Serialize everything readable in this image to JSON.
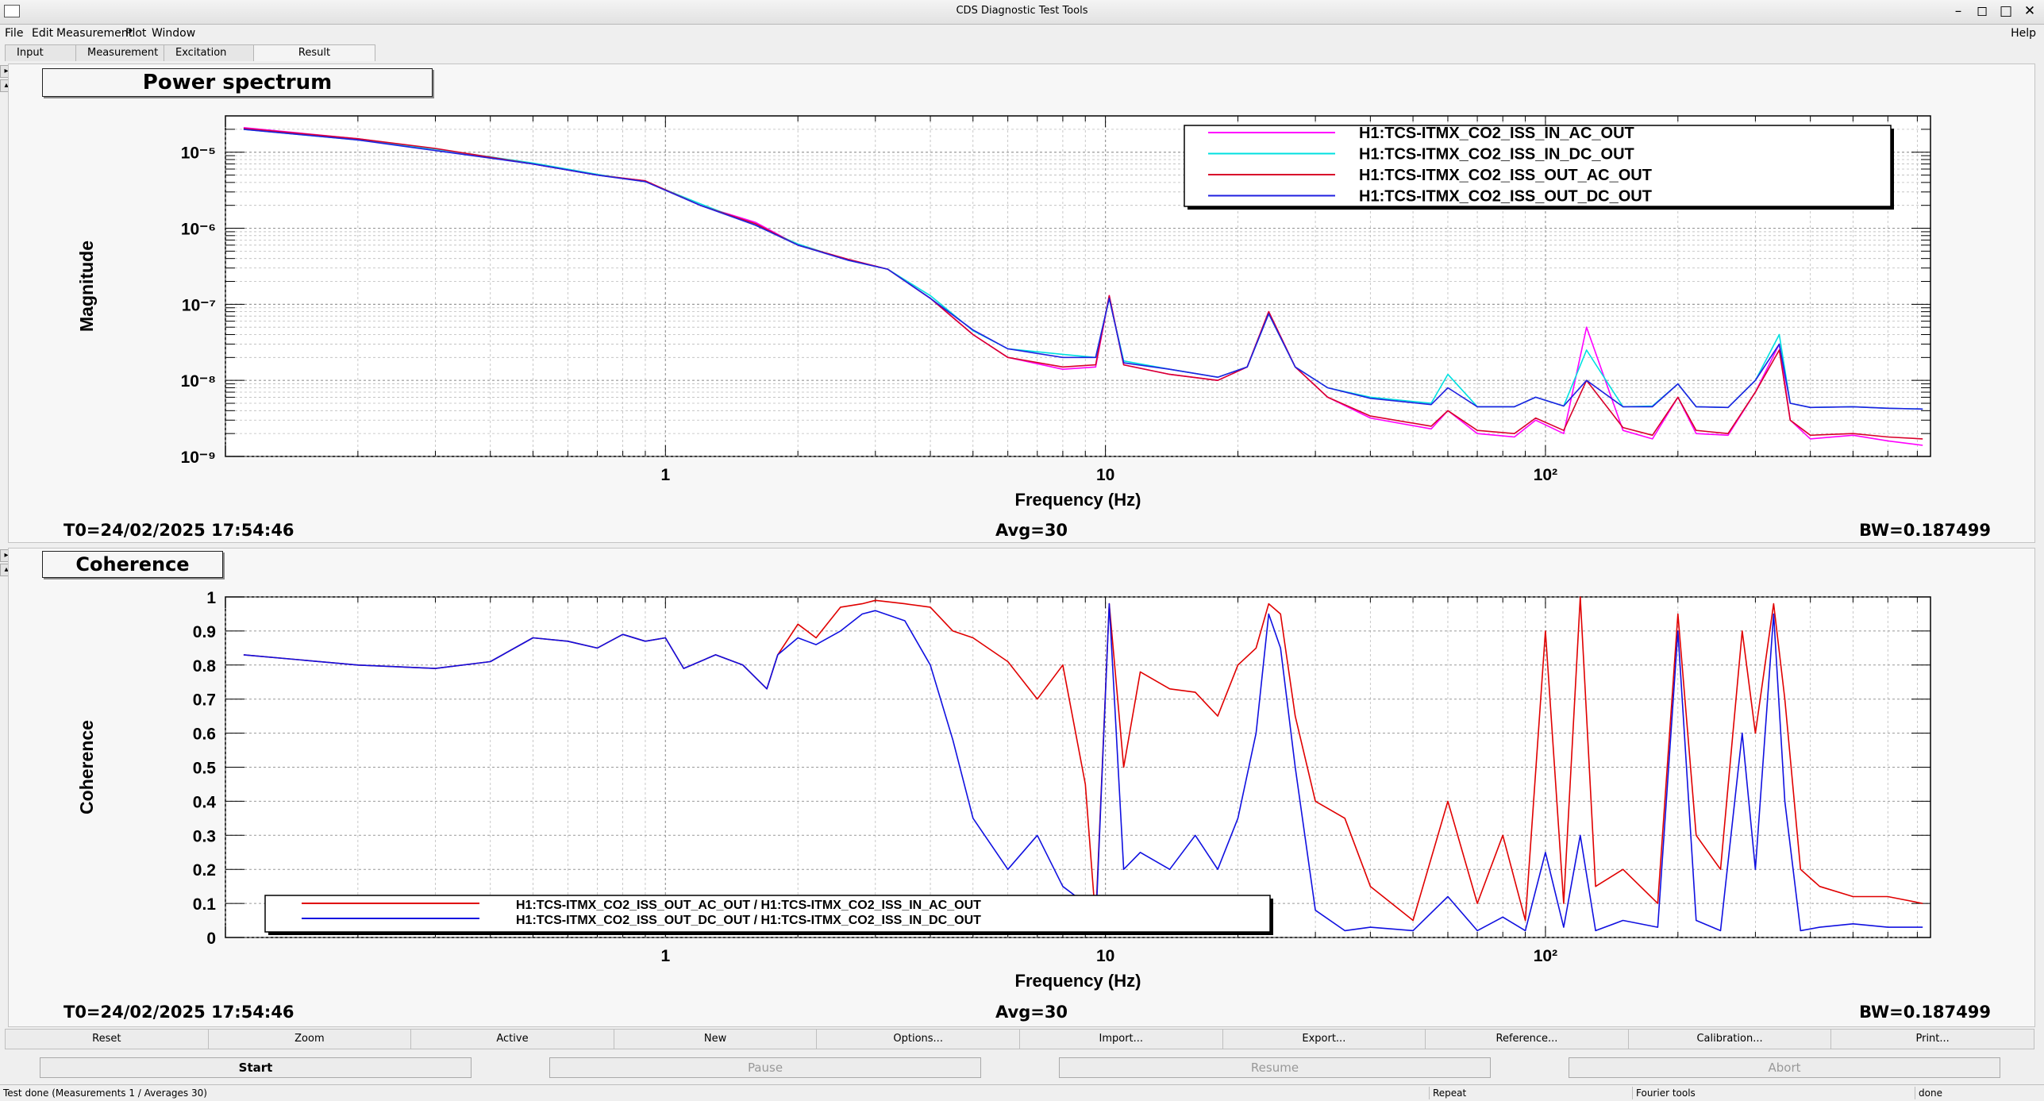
{
  "window": {
    "title": "CDS Diagnostic Test Tools"
  },
  "menu": {
    "items": [
      "File",
      "Edit",
      "Measurement",
      "Plot",
      "Window"
    ],
    "help": "Help"
  },
  "tabs": [
    "Input",
    "Measurement",
    "Excitation",
    "Result"
  ],
  "active_tab": "Result",
  "plots": [
    {
      "title": "Power spectrum",
      "ylabel": "Magnitude",
      "xlabel": "Frequency (Hz)",
      "info": {
        "t0": "T0=24/02/2025 17:54:46",
        "avg": "Avg=30",
        "bw": "BW=0.187499"
      },
      "chart_data": {
        "type": "line",
        "title": "Power spectrum",
        "xlabel": "Frequency (Hz)",
        "ylabel": "Magnitude",
        "xscale": "log",
        "yscale": "log",
        "xlim": [
          0.1,
          750
        ],
        "ylim": [
          1e-09,
          3e-05
        ],
        "grid": true,
        "legend": "top-right",
        "x_tick_labels": [
          "1",
          "10",
          "10²"
        ],
        "y_tick_labels": [
          "10⁻⁵",
          "10⁻⁶",
          "10⁻⁷",
          "10⁻⁸",
          "10⁻⁹"
        ],
        "series": [
          {
            "name": "H1:TCS-ITMX_CO2_ISS_IN_AC_OUT",
            "color": "#ff00ff",
            "x": [
              0.11,
              0.2,
              0.3,
              0.5,
              0.7,
              0.9,
              1.2,
              1.6,
              2.0,
              2.6,
              3.2,
              4.0,
              5.0,
              6.0,
              8.0,
              9.5,
              10.2,
              11,
              14,
              18,
              21,
              23.5,
              27,
              32,
              40,
              55,
              60,
              70,
              85,
              95,
              110,
              124,
              150,
              175,
              200,
              220,
              260,
              300,
              340,
              360,
              400,
              500,
              600,
              720
            ],
            "y": [
              2.1e-05,
              1.5e-05,
              1.1e-05,
              7e-06,
              5e-06,
              4.2e-06,
              2e-06,
              1.2e-06,
              6e-07,
              3.9e-07,
              2.9e-07,
              1.2e-07,
              4e-08,
              2e-08,
              1.4e-08,
              1.5e-08,
              1.3e-07,
              1.6e-08,
              1.2e-08,
              1e-08,
              1.5e-08,
              8e-08,
              1.5e-08,
              6e-09,
              3.2e-09,
              2.3e-09,
              4e-09,
              2e-09,
              1.8e-09,
              3e-09,
              2e-09,
              5e-08,
              2.2e-09,
              1.7e-09,
              6e-09,
              2e-09,
              1.9e-09,
              7e-09,
              3e-08,
              3e-09,
              1.7e-09,
              1.9e-09,
              1.6e-09,
              1.4e-09
            ]
          },
          {
            "name": "H1:TCS-ITMX_CO2_ISS_IN_DC_OUT",
            "color": "#00e0e0",
            "x": [
              0.11,
              0.2,
              0.3,
              0.5,
              0.7,
              0.9,
              1.2,
              1.6,
              2.0,
              2.6,
              3.2,
              4.0,
              5.0,
              6.0,
              8.0,
              9.5,
              10.2,
              11,
              14,
              18,
              21,
              23.5,
              27,
              32,
              40,
              55,
              60,
              70,
              85,
              95,
              110,
              124,
              150,
              175,
              200,
              220,
              260,
              300,
              340,
              360,
              400,
              500,
              600,
              720
            ],
            "y": [
              2e-05,
              1.45e-05,
              1.1e-05,
              7.2e-06,
              5.1e-06,
              4.1e-06,
              2.1e-06,
              1.1e-06,
              6.2e-07,
              3.8e-07,
              2.9e-07,
              1.3e-07,
              4.5e-08,
              2.6e-08,
              2.2e-08,
              2e-08,
              1.2e-07,
              1.8e-08,
              1.4e-08,
              1.1e-08,
              1.5e-08,
              7.5e-08,
              1.5e-08,
              8e-09,
              6e-09,
              5e-09,
              1.2e-08,
              4.5e-09,
              4.5e-09,
              6e-09,
              4.6e-09,
              2.5e-08,
              4.5e-09,
              4.6e-09,
              9e-09,
              4.5e-09,
              4.4e-09,
              1e-08,
              4e-08,
              5e-09,
              4.4e-09,
              4.5e-09,
              4.3e-09,
              4.2e-09
            ]
          },
          {
            "name": "H1:TCS-ITMX_CO2_ISS_OUT_AC_OUT",
            "color": "#d8002a",
            "x": [
              0.11,
              0.2,
              0.3,
              0.5,
              0.7,
              0.9,
              1.2,
              1.6,
              2.0,
              2.6,
              3.2,
              4.0,
              5.0,
              6.0,
              8.0,
              9.5,
              10.2,
              11,
              14,
              18,
              21,
              23.5,
              27,
              32,
              40,
              55,
              60,
              70,
              85,
              95,
              110,
              124,
              150,
              175,
              200,
              220,
              260,
              300,
              340,
              360,
              400,
              500,
              600,
              720
            ],
            "y": [
              2.05e-05,
              1.5e-05,
              1.12e-05,
              7e-06,
              5e-06,
              4.2e-06,
              2e-06,
              1.15e-06,
              6e-07,
              3.9e-07,
              2.9e-07,
              1.2e-07,
              4e-08,
              2e-08,
              1.5e-08,
              1.6e-08,
              1.3e-07,
              1.6e-08,
              1.2e-08,
              1e-08,
              1.5e-08,
              8e-08,
              1.5e-08,
              6e-09,
              3.4e-09,
              2.5e-09,
              4e-09,
              2.2e-09,
              2e-09,
              3.2e-09,
              2.2e-09,
              1e-08,
              2.4e-09,
              1.9e-09,
              6e-09,
              2.2e-09,
              2e-09,
              7e-09,
              2.5e-08,
              3e-09,
              1.9e-09,
              2e-09,
              1.8e-09,
              1.7e-09
            ]
          },
          {
            "name": "H1:TCS-ITMX_CO2_ISS_OUT_DC_OUT",
            "color": "#2020e0",
            "x": [
              0.11,
              0.2,
              0.3,
              0.5,
              0.7,
              0.9,
              1.2,
              1.6,
              2.0,
              2.6,
              3.2,
              4.0,
              5.0,
              6.0,
              8.0,
              9.5,
              10.2,
              11,
              14,
              18,
              21,
              23.5,
              27,
              32,
              40,
              55,
              60,
              70,
              85,
              95,
              110,
              124,
              150,
              175,
              200,
              220,
              260,
              300,
              340,
              360,
              400,
              500,
              600,
              720
            ],
            "y": [
              2e-05,
              1.45e-05,
              1.05e-05,
              7e-06,
              5e-06,
              4.1e-06,
              2e-06,
              1.1e-06,
              6e-07,
              3.8e-07,
              2.9e-07,
              1.2e-07,
              4.6e-08,
              2.6e-08,
              2e-08,
              2e-08,
              1.2e-07,
              1.7e-08,
              1.4e-08,
              1.1e-08,
              1.5e-08,
              7.5e-08,
              1.5e-08,
              8e-09,
              5.8e-09,
              4.8e-09,
              8e-09,
              4.5e-09,
              4.5e-09,
              6e-09,
              4.6e-09,
              1e-08,
              4.5e-09,
              4.5e-09,
              9e-09,
              4.5e-09,
              4.4e-09,
              1e-08,
              3e-08,
              5e-09,
              4.4e-09,
              4.5e-09,
              4.3e-09,
              4.2e-09
            ]
          }
        ]
      }
    },
    {
      "title": "Coherence",
      "ylabel": "Coherence",
      "xlabel": "Frequency (Hz)",
      "info": {
        "t0": "T0=24/02/2025 17:54:46",
        "avg": "Avg=30",
        "bw": "BW=0.187499"
      },
      "chart_data": {
        "type": "line",
        "title": "Coherence",
        "xlabel": "Frequency (Hz)",
        "ylabel": "Coherence",
        "xscale": "log",
        "yscale": "linear",
        "xlim": [
          0.1,
          750
        ],
        "ylim": [
          0,
          1
        ],
        "grid": true,
        "legend": "bottom-left",
        "x_tick_labels": [
          "1",
          "10",
          "10²"
        ],
        "y_tick_labels": [
          "0",
          "0.1",
          "0.2",
          "0.3",
          "0.4",
          "0.5",
          "0.6",
          "0.7",
          "0.8",
          "0.9",
          "1"
        ],
        "series": [
          {
            "name": "H1:TCS-ITMX_CO2_ISS_OUT_AC_OUT / H1:TCS-ITMX_CO2_ISS_IN_AC_OUT",
            "color": "#e00000",
            "x": [
              0.11,
              0.2,
              0.3,
              0.4,
              0.5,
              0.6,
              0.7,
              0.8,
              0.9,
              1.0,
              1.1,
              1.3,
              1.5,
              1.7,
              1.8,
              2.0,
              2.2,
              2.5,
              2.8,
              3.0,
              3.5,
              4.0,
              4.5,
              5.0,
              6.0,
              7.0,
              8.0,
              9.0,
              9.5,
              10.2,
              11,
              12,
              14,
              16,
              18,
              20,
              22,
              23.5,
              25,
              27,
              30,
              35,
              40,
              50,
              60,
              70,
              80,
              90,
              100,
              110,
              120,
              130,
              150,
              180,
              200,
              220,
              250,
              280,
              300,
              330,
              350,
              380,
              420,
              500,
              600,
              720
            ],
            "y": [
              0.83,
              0.8,
              0.79,
              0.81,
              0.88,
              0.87,
              0.85,
              0.89,
              0.87,
              0.88,
              0.79,
              0.83,
              0.8,
              0.73,
              0.83,
              0.92,
              0.88,
              0.97,
              0.98,
              0.99,
              0.98,
              0.97,
              0.9,
              0.88,
              0.81,
              0.7,
              0.8,
              0.45,
              0.05,
              0.98,
              0.5,
              0.78,
              0.73,
              0.72,
              0.65,
              0.8,
              0.85,
              0.98,
              0.95,
              0.65,
              0.4,
              0.35,
              0.15,
              0.05,
              0.4,
              0.1,
              0.3,
              0.05,
              0.9,
              0.1,
              1.0,
              0.15,
              0.2,
              0.1,
              0.95,
              0.3,
              0.2,
              0.9,
              0.6,
              0.98,
              0.7,
              0.2,
              0.15,
              0.12,
              0.12,
              0.1
            ]
          },
          {
            "name": "H1:TCS-ITMX_CO2_ISS_OUT_DC_OUT / H1:TCS-ITMX_CO2_ISS_IN_DC_OUT",
            "color": "#1010e0",
            "x": [
              0.11,
              0.2,
              0.3,
              0.4,
              0.5,
              0.6,
              0.7,
              0.8,
              0.9,
              1.0,
              1.1,
              1.3,
              1.5,
              1.7,
              1.8,
              2.0,
              2.2,
              2.5,
              2.8,
              3.0,
              3.5,
              4.0,
              4.5,
              5.0,
              6.0,
              7.0,
              8.0,
              9.0,
              9.5,
              10.2,
              11,
              12,
              14,
              16,
              18,
              20,
              22,
              23.5,
              25,
              27,
              30,
              35,
              40,
              50,
              60,
              70,
              80,
              90,
              100,
              110,
              120,
              130,
              150,
              180,
              200,
              220,
              250,
              280,
              300,
              330,
              350,
              380,
              420,
              500,
              600,
              720
            ],
            "y": [
              0.83,
              0.8,
              0.79,
              0.81,
              0.88,
              0.87,
              0.85,
              0.89,
              0.87,
              0.88,
              0.79,
              0.83,
              0.8,
              0.73,
              0.83,
              0.88,
              0.86,
              0.9,
              0.95,
              0.96,
              0.93,
              0.8,
              0.58,
              0.35,
              0.2,
              0.3,
              0.15,
              0.1,
              0.03,
              0.98,
              0.2,
              0.25,
              0.2,
              0.3,
              0.2,
              0.35,
              0.6,
              0.95,
              0.85,
              0.5,
              0.08,
              0.02,
              0.03,
              0.02,
              0.12,
              0.02,
              0.06,
              0.02,
              0.25,
              0.03,
              0.3,
              0.02,
              0.05,
              0.03,
              0.9,
              0.05,
              0.02,
              0.6,
              0.2,
              0.95,
              0.4,
              0.02,
              0.03,
              0.04,
              0.03,
              0.03
            ]
          }
        ]
      }
    }
  ],
  "bottom_buttons": [
    "Reset",
    "Zoom",
    "Active",
    "New",
    "Options...",
    "Import...",
    "Export...",
    "Reference...",
    "Calibration...",
    "Print..."
  ],
  "controls": {
    "start": "Start",
    "pause": "Pause",
    "resume": "Resume",
    "abort": "Abort"
  },
  "status": {
    "message": "Test done (Measurements 1 / Averages 30)",
    "mode": "Repeat",
    "tool": "Fourier tools",
    "state": "done"
  }
}
